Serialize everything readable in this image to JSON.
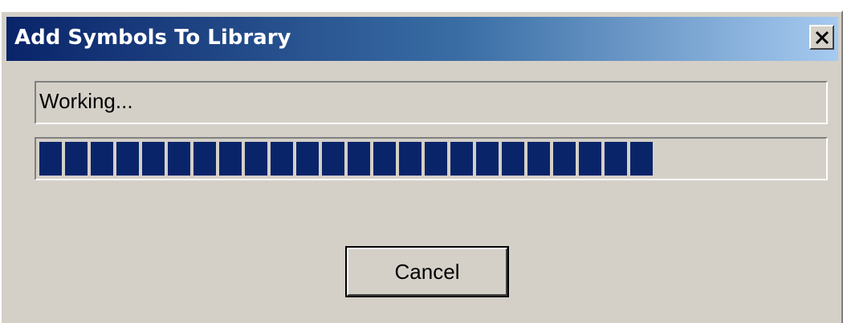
{
  "window": {
    "title": "Add Symbols To Library",
    "title_bar_colors": [
      "#0a246a",
      "#3a6ea5",
      "#a6caf0"
    ],
    "close_icon": "close-x-icon"
  },
  "status": {
    "text": "Working..."
  },
  "progress": {
    "fraction": 0.8,
    "color": "#0a246a"
  },
  "buttons": {
    "cancel_label": "Cancel"
  }
}
